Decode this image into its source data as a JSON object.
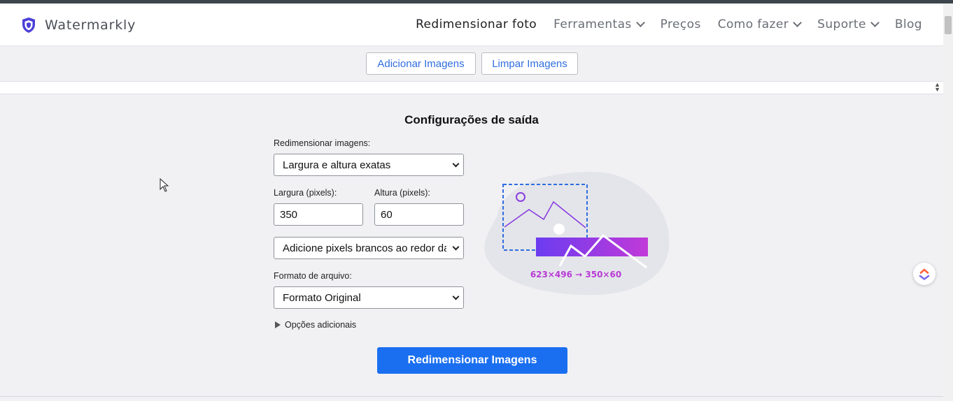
{
  "brand": {
    "name": "Watermarkly",
    "accent": "#4b3fd8"
  },
  "nav": {
    "items": [
      {
        "label": "Redimensionar foto",
        "active": true,
        "dropdown": false
      },
      {
        "label": "Ferramentas",
        "active": false,
        "dropdown": true
      },
      {
        "label": "Preços",
        "active": false,
        "dropdown": false
      },
      {
        "label": "Como fazer",
        "active": false,
        "dropdown": true
      },
      {
        "label": "Suporte",
        "active": false,
        "dropdown": true
      },
      {
        "label": "Blog",
        "active": false,
        "dropdown": false
      }
    ]
  },
  "toolbar": {
    "add_label": "Adicionar Imagens",
    "clear_label": "Limpar Imagens"
  },
  "settings": {
    "title": "Configurações de saída",
    "resize_label": "Redimensionar imagens:",
    "resize_value": "Largura e altura exatas",
    "width_label": "Largura (pixels):",
    "width_value": "350",
    "height_label": "Altura (pixels):",
    "height_value": "60",
    "fill_value": "Adicione pixels brancos ao redor da",
    "format_label": "Formato de arquivo:",
    "format_value": "Formato Original",
    "more_options": "Opções adicionais",
    "submit_label": "Redimensionar Imagens"
  },
  "illustration": {
    "caption": "623×496 → 350×60"
  },
  "colors": {
    "primary_button": "#1a6ff0",
    "link_blue": "#2f6de0",
    "gradient_start": "#6b3cf0",
    "gradient_end": "#c13ad8"
  }
}
